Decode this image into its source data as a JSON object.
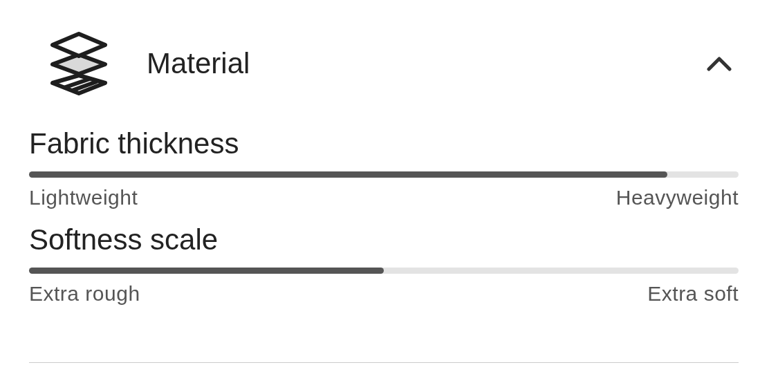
{
  "section": {
    "title": "Material",
    "expanded": true
  },
  "scales": [
    {
      "label": "Fabric thickness",
      "level": 0.9,
      "min_label": "Lightweight",
      "max_label": "Heavyweight"
    },
    {
      "label": "Softness scale",
      "level": 0.5,
      "min_label": "Extra rough",
      "max_label": "Extra soft"
    }
  ]
}
